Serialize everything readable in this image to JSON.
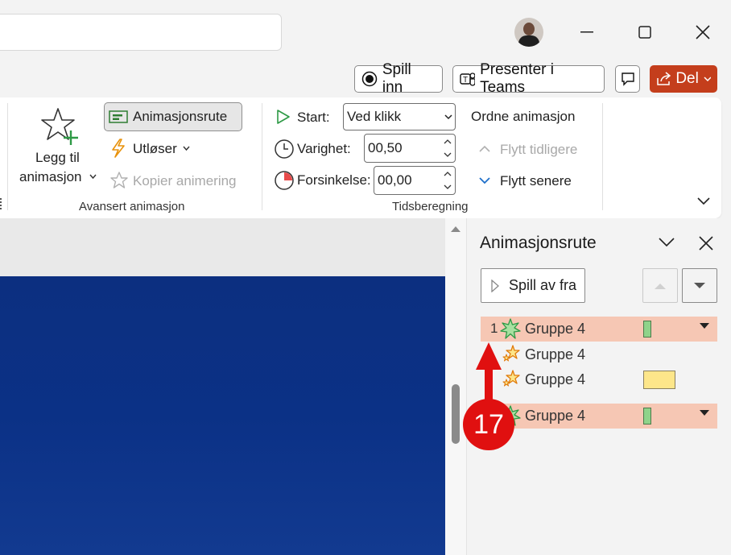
{
  "actions": {
    "record_label": "Spill inn",
    "teams_label": "Presenter i Teams",
    "share_label": "Del"
  },
  "ribbon": {
    "add_animation_line1": "Legg til",
    "add_animation_line2": "animasjon",
    "animation_pane_label": "Animasjonsrute",
    "trigger_label": "Utløser",
    "copy_animation_label": "Kopier animering",
    "advanced_group_label": "Avansert animasjon",
    "start_label": "Start:",
    "start_value": "Ved klikk",
    "duration_label": "Varighet:",
    "duration_value": "00,50",
    "delay_label": "Forsinkelse:",
    "delay_value": "00,00",
    "timing_group_label": "Tidsberegning",
    "reorder_title": "Ordne animasjon",
    "move_earlier_label": "Flytt tidligere",
    "move_later_label": "Flytt senere"
  },
  "pane": {
    "title": "Animasjonsrute",
    "play_from_label": "Spill av fra",
    "items": [
      {
        "number": "1",
        "label": "Gruppe 4",
        "selected": true,
        "icon": "entrance-star-icon"
      },
      {
        "number": "",
        "label": "Gruppe 4",
        "selected": false,
        "icon": "emphasis-star-icon"
      },
      {
        "number": "",
        "label": "Gruppe 4",
        "selected": false,
        "icon": "emphasis-star-icon"
      },
      {
        "number": "",
        "label": "Gruppe 4",
        "selected": true,
        "icon": "entrance-star-icon"
      }
    ]
  },
  "annotation": {
    "step_number": "17",
    "color": "#e01010"
  },
  "colors": {
    "share": "#c43e1c",
    "slide": "#0c2f80",
    "selected_row": "#f6c7b4"
  }
}
